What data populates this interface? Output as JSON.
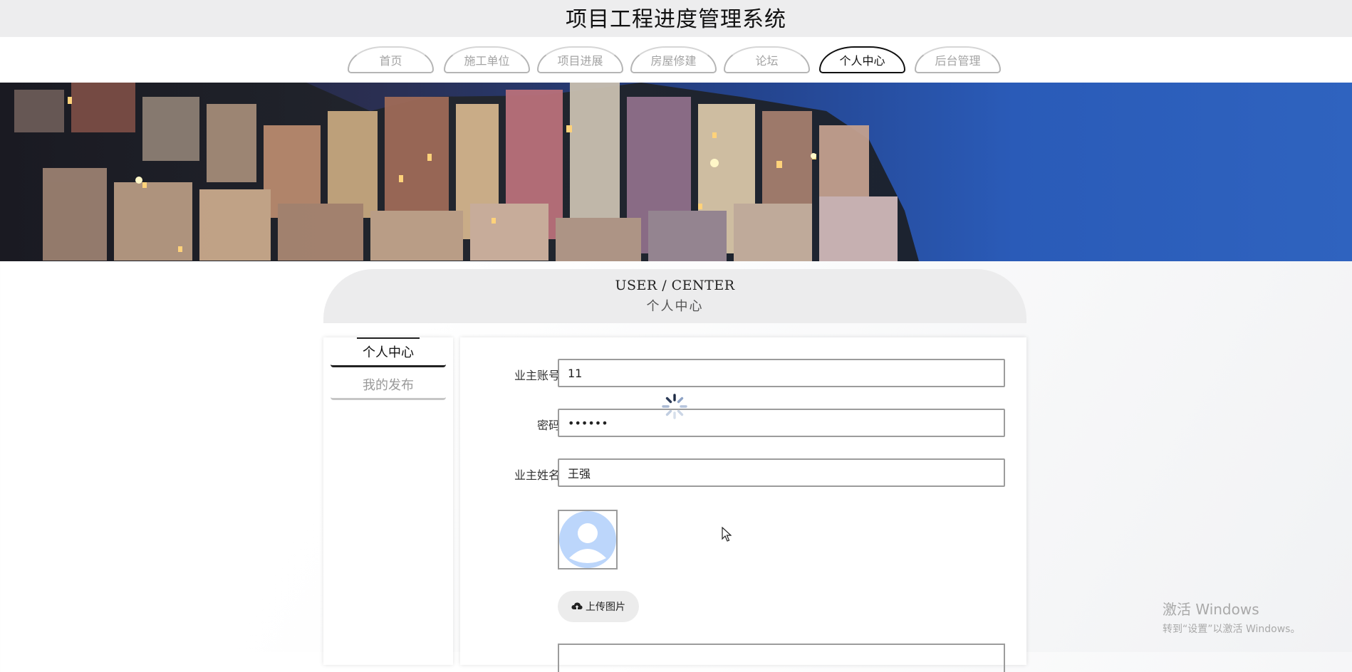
{
  "header": {
    "title": "项目工程进度管理系统"
  },
  "nav": {
    "tabs": [
      {
        "label": "首页",
        "active": false
      },
      {
        "label": "施工单位",
        "active": false
      },
      {
        "label": "项目进展",
        "active": false
      },
      {
        "label": "房屋修建",
        "active": false
      },
      {
        "label": "论坛",
        "active": false
      },
      {
        "label": "个人中心",
        "active": true
      },
      {
        "label": "后台管理",
        "active": false
      }
    ]
  },
  "section": {
    "title_en": "USER / CENTER",
    "title_zh": "个人中心"
  },
  "side_menu": {
    "items": [
      {
        "label": "个人中心",
        "active": true
      },
      {
        "label": "我的发布",
        "active": false
      }
    ]
  },
  "form": {
    "account": {
      "label": "业主账号",
      "value": "11"
    },
    "password": {
      "label": "密码",
      "value": "••••••"
    },
    "name": {
      "label": "业主姓名",
      "value": "王强"
    },
    "avatar": {
      "icon": "user-avatar-icon"
    },
    "upload": {
      "label": "上传图片",
      "icon": "cloud-upload-icon"
    }
  },
  "watermark": {
    "line1": "激活 Windows",
    "line2": "转到“设置”以激活 Windows。"
  },
  "colors": {
    "nav_active": "#111111",
    "nav_inactive": "#a3a3a3",
    "avatar_blue": "#bcd6fb",
    "upload_bg": "#ececec"
  }
}
